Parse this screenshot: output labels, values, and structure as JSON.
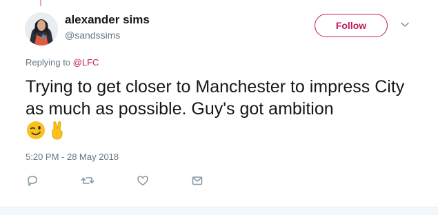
{
  "user": {
    "display_name": "alexander sims",
    "handle": "@sandssims",
    "avatar_icon": "avatar-photo"
  },
  "follow_button": {
    "label": "Follow",
    "color": "#c2185b"
  },
  "reply": {
    "prefix": "Replying to ",
    "mention": "@LFC"
  },
  "tweet": {
    "text": "Trying to get closer to Manchester to impress City as much as possible. Guy's got ambition",
    "emojis": [
      "winking-face-icon",
      "victory-hand-icon"
    ]
  },
  "timestamp": "5:20 PM - 28 May 2018",
  "actions": [
    "reply-icon",
    "retweet-icon",
    "like-icon",
    "direct-message-icon"
  ],
  "colors": {
    "accent": "#c2185b",
    "text": "#14171a",
    "muted": "#657786",
    "emoji_yellow": "#fcc21b"
  }
}
